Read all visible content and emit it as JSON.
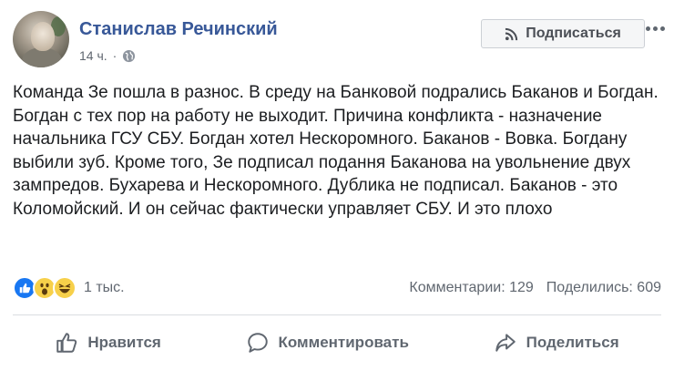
{
  "post": {
    "author": "Станислав Речинский",
    "time": "14 ч.",
    "audience_icon": "globe-icon",
    "follow_label": "Подписаться",
    "follow_icon": "rss-icon",
    "more_icon": "more-dots-icon",
    "text": "Команда Зе пошла в разнос. В среду на Банковой подрались Баканов и Богдан. Богдан с тех пор на работу не выходит. Причина конфликта - назначение начальника ГСУ СБУ. Богдан хотел Нескоромного. Баканов - Вовка. Богдану выбили зуб. Кроме того, Зе подписал подання Баканова на увольнение двух зампредов. Бухарева и Нескоромного. Дублика не подписал. Баканов - это Коломойский. И он сейчас фактически управляет СБУ. И это плохо"
  },
  "stats": {
    "reactions": [
      "like",
      "wow",
      "haha"
    ],
    "reaction_count": "1 тыс.",
    "comments": "Комментарии: 129",
    "shares": "Поделились: 609"
  },
  "actions": {
    "like": "Нравится",
    "comment": "Комментировать",
    "share": "Поделиться"
  },
  "colors": {
    "author": "#385898",
    "like_blue": "#1877f2",
    "secondary_text": "#606770",
    "divider": "#dadde1"
  }
}
